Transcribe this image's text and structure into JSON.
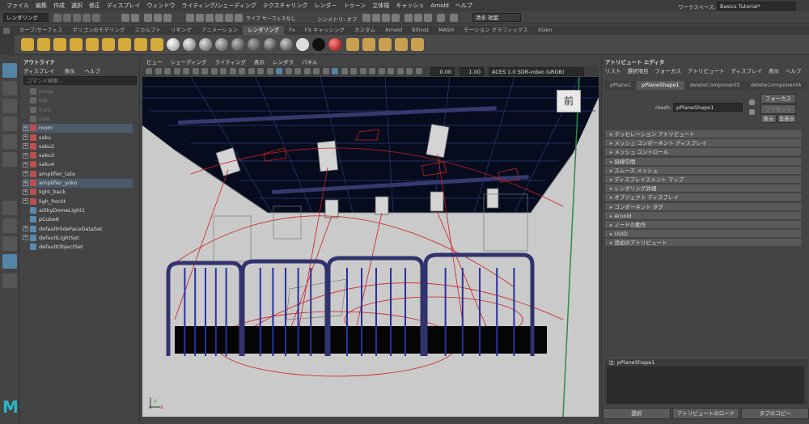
{
  "menu": [
    "ファイル",
    "編集",
    "作成",
    "選択",
    "修正",
    "ディスプレイ",
    "ウィンドウ",
    "ライティング/シェーディング",
    "テクスチャリング",
    "レンダー",
    "トゥーン",
    "立体視",
    "キャッシュ",
    "Arnold",
    "ヘルプ"
  ],
  "workspace": {
    "label": "ワークスペース:",
    "value": "Basics Tutorial*"
  },
  "status": {
    "mode": "レンダリング",
    "live": "ライブ サーフェスなし",
    "symmetry": "シンメトリ: オフ",
    "user": "清永 祐葉"
  },
  "shelf_tabs": [
    "カーブ/サーフェス",
    "ポリゴンのモデリング",
    "スカルプト",
    "リギング",
    "アニメーション",
    "レンダリング",
    "Fx",
    "FX キャッシング",
    "カスタム",
    "Arnold",
    "Bifrost",
    "MASH",
    "モーション グラフィックス",
    "XGen"
  ],
  "shelf_active": 5,
  "outliner": {
    "title": "アウトライナ",
    "menu": [
      "ディスプレイ",
      "表示",
      "ヘルプ"
    ],
    "search": "コマンド検索...",
    "items": [
      {
        "label": "persp",
        "dim": true,
        "exp": false
      },
      {
        "label": "top",
        "dim": true,
        "exp": false
      },
      {
        "label": "front",
        "dim": true,
        "exp": false
      },
      {
        "label": "side",
        "dim": true,
        "exp": false
      },
      {
        "label": "room",
        "sel": true,
        "exp": true
      },
      {
        "label": "saku",
        "exp": true
      },
      {
        "label": "saku2",
        "exp": true
      },
      {
        "label": "saku3",
        "exp": true
      },
      {
        "label": "saku4",
        "exp": true
      },
      {
        "label": "amplifier_tate",
        "exp": true
      },
      {
        "label": "amplifier_yoko",
        "sel": true,
        "exp": true
      },
      {
        "label": "light_back",
        "exp": true
      },
      {
        "label": "ligh_frontt",
        "exp": true
      },
      {
        "label": "aiSkyDomeLight1",
        "exp": false
      },
      {
        "label": "pCube8",
        "exp": false
      },
      {
        "label": "defaultHideFaceDataSet",
        "exp": true
      },
      {
        "label": "defaultLightSet",
        "exp": true
      },
      {
        "label": "defaultObjectSet",
        "exp": false
      }
    ]
  },
  "viewport": {
    "menu": [
      "ビュー",
      "シェーディング",
      "ライティング",
      "表示",
      "レンダラ",
      "パネル"
    ],
    "field1": "0.00",
    "field2": "1.00",
    "colorspace": "ACES 1.0 SDR-video (sRGB)",
    "cube_label": "前"
  },
  "attr": {
    "title": "アトリビュート エディタ",
    "menu": [
      "リスト",
      "選択項目",
      "フォーカス",
      "アトリビュート",
      "ディスプレイ",
      "表示",
      "ヘルプ"
    ],
    "tabs": [
      "pPlane1",
      "pPlaneShape1",
      "deleteComponent5",
      "deleteComponent4"
    ],
    "tab_active": 1,
    "mesh_label": "mesh:",
    "mesh_value": "pPlaneShape1",
    "focus": "フォーカス",
    "preset": "プリセット",
    "show": "表示",
    "hide": "非表示",
    "sections": [
      "テッセレーション アトリビュート",
      "メッシュ コンポーネント ディスプレイ",
      "メッシュ コントロール",
      "接線空間",
      "スムーズ メッシュ",
      "ディスプレイスメント マップ",
      "レンダリング詳細",
      "オブジェクト ディスプレイ",
      "コンポーネント タグ",
      "Arnold",
      "ノードの動作",
      "UUID",
      "追加のアトリビュート"
    ],
    "notes": "注: pPlaneShape1",
    "buttons": [
      "選択",
      "アトリビュートのロード",
      "タブのコピー"
    ]
  },
  "colors": {
    "accent": "#5285a6",
    "select": "#4d5a6a",
    "light_line": "#c81e1e",
    "fence": "#32326e"
  }
}
